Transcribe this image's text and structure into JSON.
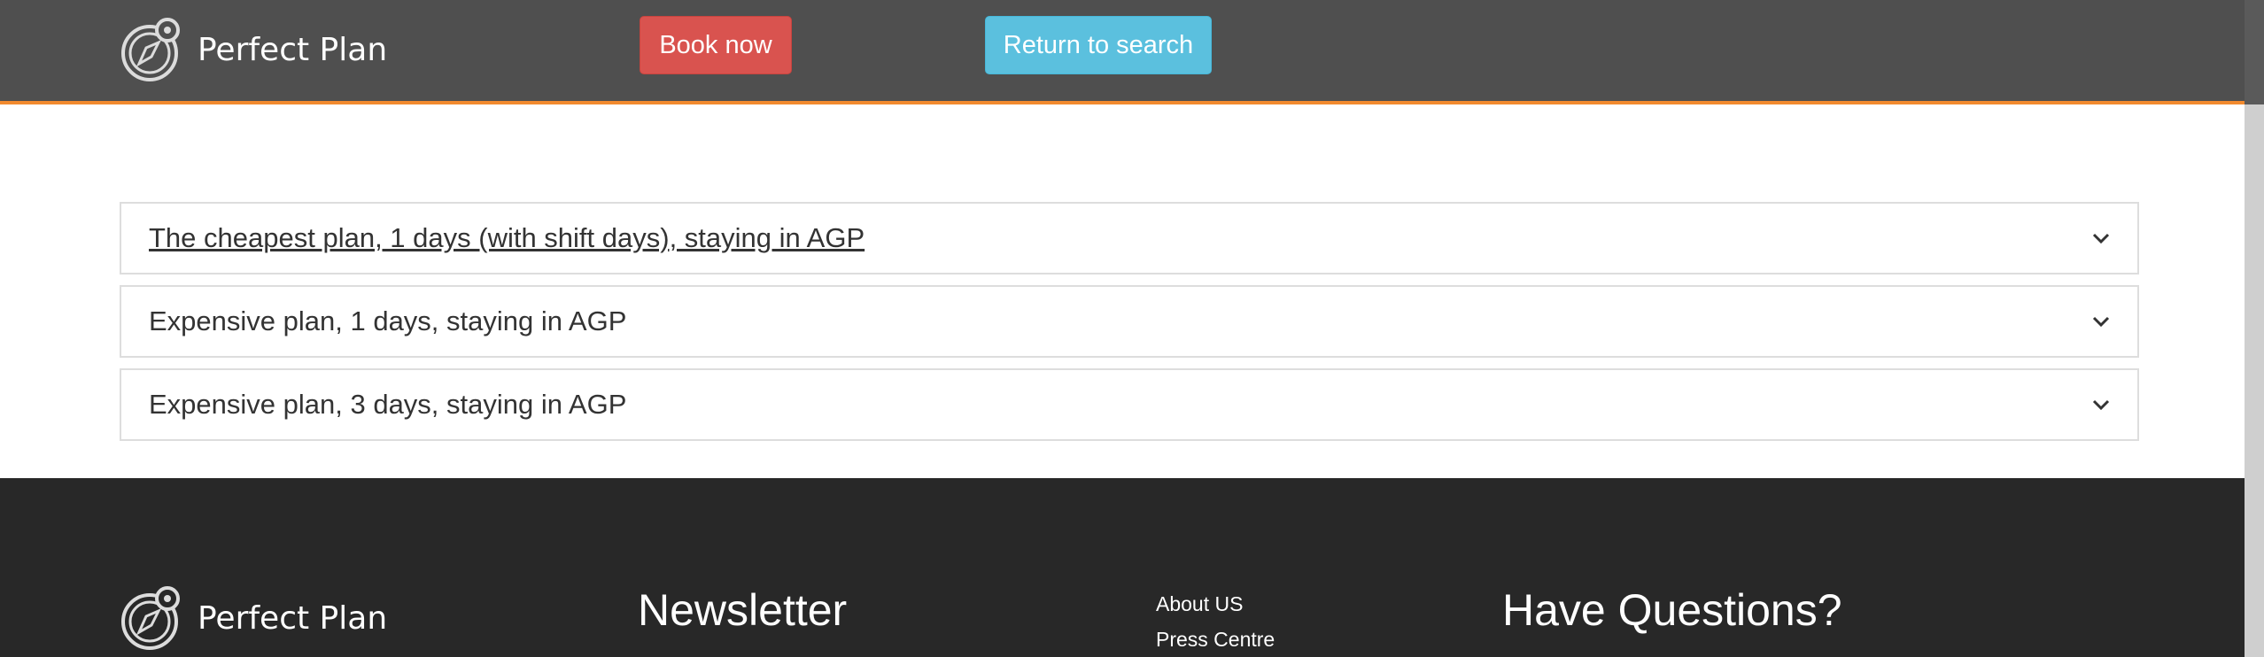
{
  "header": {
    "brand_name": "Perfect Plan",
    "book_label": "Book now",
    "return_label": "Return to search"
  },
  "plans": [
    {
      "title": "The cheapest plan, 1 days (with shift days), staying in AGP"
    },
    {
      "title": "Expensive plan, 1 days, staying in AGP"
    },
    {
      "title": "Expensive plan, 3 days, staying in AGP"
    }
  ],
  "footer": {
    "brand_name": "Perfect Plan",
    "newsletter_heading": "Newsletter",
    "links": [
      "About US",
      "Press Centre"
    ],
    "questions_heading": "Have Questions?"
  },
  "colors": {
    "header_bg": "#4f4f4f",
    "header_accent": "#f28a2e",
    "book_button": "#d9534f",
    "return_button": "#5bc0de",
    "footer_bg": "#282828"
  },
  "icons": {
    "logo": "compass-logo-icon",
    "expand": "chevron-down-icon"
  }
}
